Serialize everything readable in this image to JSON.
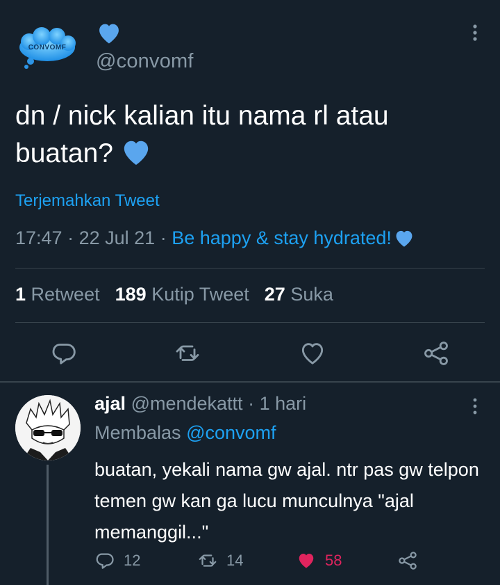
{
  "tweet": {
    "handle": "@convomf",
    "avatar_text": "CONVOMF",
    "text": "dn / nick kalian itu nama rl atau buatan?",
    "translate_label": "Terjemahkan Tweet",
    "time": "17:47",
    "date": "22 Jul 21",
    "separator": "·",
    "source": "Be happy & stay hydrated!",
    "stats": {
      "retweets_count": "1",
      "retweets_label": "Retweet",
      "quotes_count": "189",
      "quotes_label": "Kutip Tweet",
      "likes_count": "27",
      "likes_label": "Suka"
    }
  },
  "reply": {
    "name": "ajal",
    "handle": "@mendekattt",
    "age": "1 hari",
    "replying_label": "Membalas",
    "replying_to": "@convomf",
    "text": "buatan, yekali nama gw ajal. ntr pas gw telpon temen gw kan ga lucu munculnya \"ajal memanggil...\"",
    "replies_count": "12",
    "retweets_count": "14",
    "likes_count": "58",
    "liked": true
  },
  "icons": {
    "heart": "blue-heart-icon",
    "more": "more-vertical-icon",
    "reply": "reply-icon",
    "retweet": "retweet-icon",
    "like": "like-icon",
    "share": "share-icon"
  },
  "colors": {
    "background": "#15202b",
    "accent": "#1da1f2",
    "muted": "#8899a6",
    "heart_blue": "#5aa6ee",
    "like_red": "#e0245e",
    "divider": "#38444d"
  }
}
